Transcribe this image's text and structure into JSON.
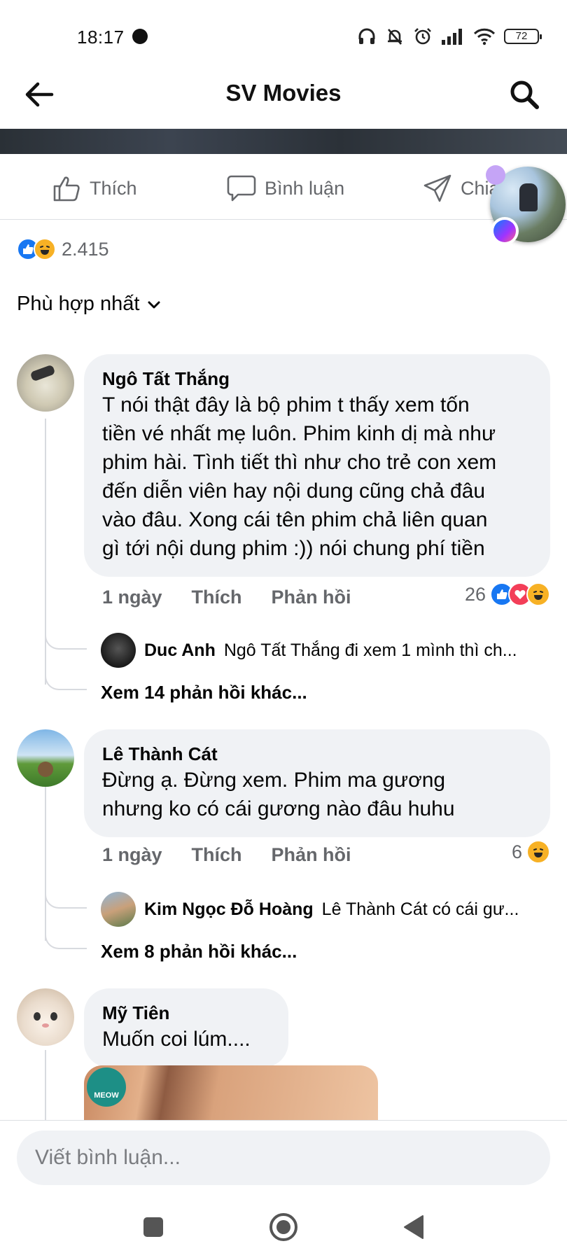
{
  "status_bar": {
    "time": "18:17",
    "battery": "72"
  },
  "header": {
    "title": "SV Movies"
  },
  "actions": {
    "like": "Thích",
    "comment": "Bình luận",
    "share": "Chia"
  },
  "reactions_summary": {
    "count": "2.415"
  },
  "sort": {
    "label": "Phù hợp nhất"
  },
  "comments": [
    {
      "name": "Ngô Tất Thắng",
      "lines": [
        "T nói thật đây là bộ phim t thấy xem tốn",
        "tiền vé nhất mẹ luôn. Phim kinh dị mà như",
        "phim hài. Tình tiết thì như cho trẻ con xem",
        "đến diễn viên hay nội dung cũng chả đâu",
        "vào đâu. Xong cái tên phim chả liên quan",
        "gì tới nội dung phim :)) nói chung phí tiền"
      ],
      "time": "1 ngày",
      "like": "Thích",
      "reply": "Phản hồi",
      "reaction_count": "26",
      "reply_preview": {
        "name": "Duc Anh",
        "text": "Ngô Tất Thắng đi xem 1 mình thì ch..."
      },
      "more_replies": "Xem 14 phản hồi khác..."
    },
    {
      "name": "Lê Thành Cát",
      "lines": [
        "Đừng ạ. Đừng xem. Phim ma gương",
        "nhưng ko có cái gương nào đâu huhu"
      ],
      "time": "1 ngày",
      "like": "Thích",
      "reply": "Phản hồi",
      "reaction_count": "6",
      "reply_preview": {
        "name": "Kim Ngọc Đỗ Hoàng",
        "text": "Lê Thành Cát có cái gư..."
      },
      "more_replies": "Xem 8 phản hồi khác..."
    },
    {
      "name": "Mỹ Tiên",
      "lines": [
        "Muốn coi lúm...."
      ],
      "sticker_label": "MEOW"
    }
  ],
  "composer": {
    "placeholder": "Viết bình luận..."
  }
}
